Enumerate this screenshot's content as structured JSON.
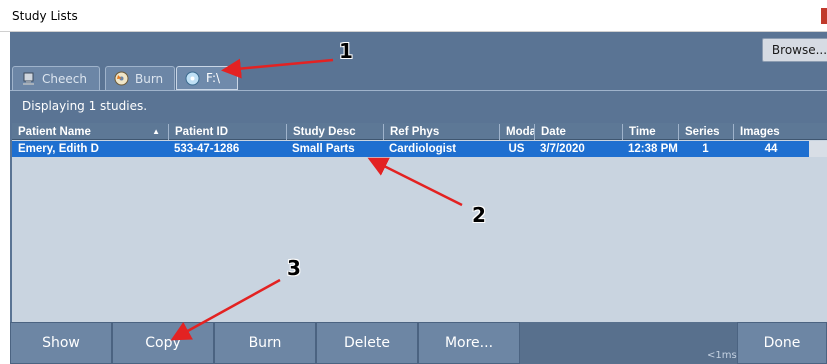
{
  "window": {
    "title": "Study Lists"
  },
  "toolbar": {
    "browse_label": "Browse..."
  },
  "tabs": [
    {
      "label": "Cheech",
      "icon": "server-icon"
    },
    {
      "label": "Burn",
      "icon": "disc-burn-icon"
    },
    {
      "label": "F:\\",
      "icon": "cd-drive-icon"
    }
  ],
  "status": {
    "text": "Displaying 1 studies."
  },
  "table": {
    "columns": [
      "Patient Name",
      "Patient ID",
      "Study Desc",
      "Ref Phys",
      "Moda",
      "Date",
      "Time",
      "Series",
      "Images"
    ],
    "rows": [
      [
        "Emery, Edith D",
        "533-47-1286",
        "Small Parts",
        "Cardiologist",
        "US",
        "3/7/2020",
        "12:38 PM",
        "1",
        "44"
      ]
    ]
  },
  "buttons": {
    "show": "Show",
    "copy": "Copy",
    "burn": "Burn",
    "delete": "Delete",
    "more": "More...",
    "done": "Done"
  },
  "timer": "<1ms",
  "annotations": [
    "1",
    "2",
    "3"
  ],
  "colors": {
    "accent_selection": "#1e6fd0",
    "panel": "#5a7494",
    "callout_arrow": "#e32222"
  }
}
